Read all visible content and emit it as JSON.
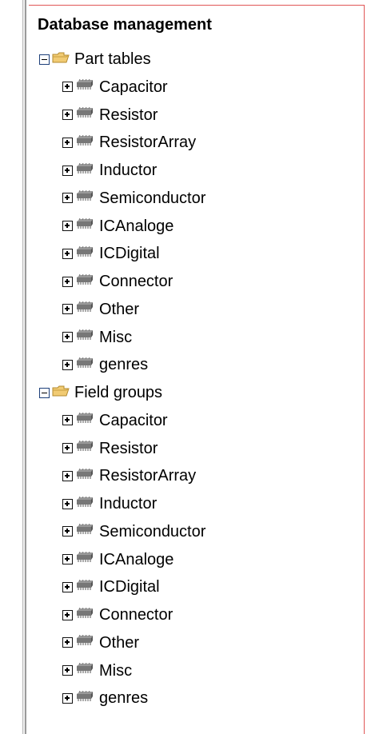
{
  "tree": {
    "title": "Database management",
    "groups": [
      {
        "label": "Part tables",
        "icon": "folder-icon",
        "expanded": true,
        "items": [
          "Capacitor",
          "Resistor",
          "ResistorArray",
          "Inductor",
          "Semiconductor",
          "ICAnaloge",
          "ICDigital",
          "Connector",
          "Other",
          "Misc",
          "genres"
        ]
      },
      {
        "label": "Field groups",
        "icon": "folder-icon",
        "expanded": true,
        "items": [
          "Capacitor",
          "Resistor",
          "ResistorArray",
          "Inductor",
          "Semiconductor",
          "ICAnaloge",
          "ICDigital",
          "Connector",
          "Other",
          "Misc",
          "genres"
        ]
      }
    ],
    "item_icon": "table-icon",
    "colors": {
      "panel_border": "#e05656",
      "folder": "#e2b75a",
      "toggle_border": "#1d3f7a"
    }
  }
}
